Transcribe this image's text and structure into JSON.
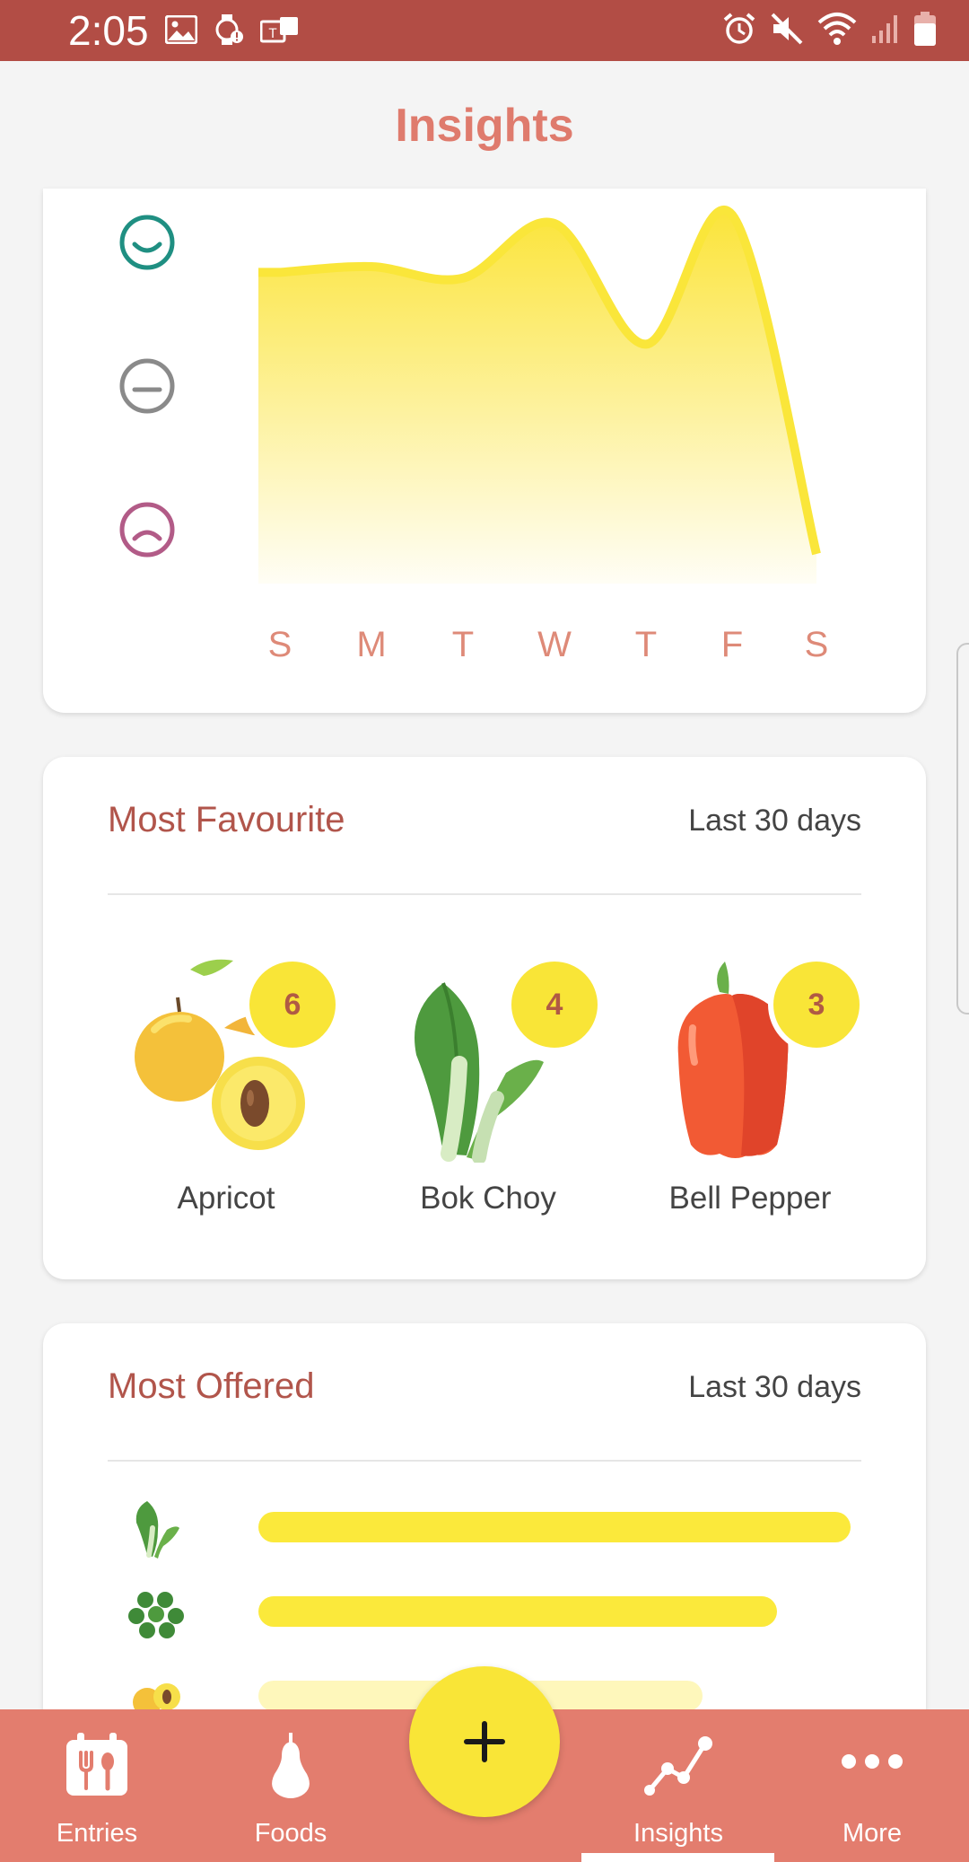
{
  "status_bar": {
    "time": "2:05",
    "left_icons": [
      "image-icon",
      "watch-alert-icon",
      "teams-icon"
    ],
    "right_icons": [
      "alarm-icon",
      "mute-icon",
      "wifi-icon",
      "signal-icon",
      "battery-icon"
    ]
  },
  "header": {
    "title": "Insights"
  },
  "mood_card": {
    "mood_levels": [
      "happy-face-icon",
      "neutral-face-icon",
      "sad-face-icon"
    ],
    "chart_data": {
      "type": "area",
      "x": [
        "S",
        "M",
        "T",
        "W",
        "T",
        "F",
        "S"
      ],
      "y_scale": [
        "sad",
        "neutral",
        "happy"
      ],
      "values": [
        {
          "x": "S",
          "mood": 0.88
        },
        {
          "x": "M",
          "mood": 0.9
        },
        {
          "x": "T",
          "mood": 0.86
        },
        {
          "x": "W",
          "mood": 1.05
        },
        {
          "x": "T",
          "mood": 0.63
        },
        {
          "x": "F",
          "mood": 1.08
        },
        {
          "x": "S",
          "mood": -0.1
        }
      ],
      "fill_color": "#fbe93b",
      "grid": false
    },
    "day_labels": [
      "S",
      "M",
      "T",
      "W",
      "T",
      "F",
      "S"
    ]
  },
  "favourite_card": {
    "title": "Most Favourite",
    "range": "Last 30 days",
    "items": [
      {
        "name": "Apricot",
        "count": "6",
        "icon": "apricot-icon"
      },
      {
        "name": "Bok Choy",
        "count": "4",
        "icon": "bok-choy-icon"
      },
      {
        "name": "Bell Pepper",
        "count": "3",
        "icon": "bell-pepper-icon"
      }
    ]
  },
  "offered_card": {
    "title": "Most Offered",
    "range": "Last 30 days",
    "items": [
      {
        "icon": "bok-choy-icon",
        "level": 1.0
      },
      {
        "icon": "peas-icon",
        "level": 0.875
      },
      {
        "icon": "apricot-icon",
        "level": 0.75
      }
    ]
  },
  "bottom_nav": {
    "items": [
      {
        "label": "Entries",
        "icon": "calendar-cutlery-icon"
      },
      {
        "label": "Foods",
        "icon": "pear-icon"
      },
      {
        "label": "Insights",
        "icon": "trend-line-icon"
      },
      {
        "label": "More",
        "icon": "more-dots-icon"
      }
    ],
    "fab_icon": "plus-icon",
    "active": "Insights"
  },
  "colors": {
    "status_bar": "#b24d45",
    "accent": "#df7b6d",
    "nav_bg": "#e37d6e",
    "yellow": "#f9e537",
    "card_title": "#b1554b"
  }
}
